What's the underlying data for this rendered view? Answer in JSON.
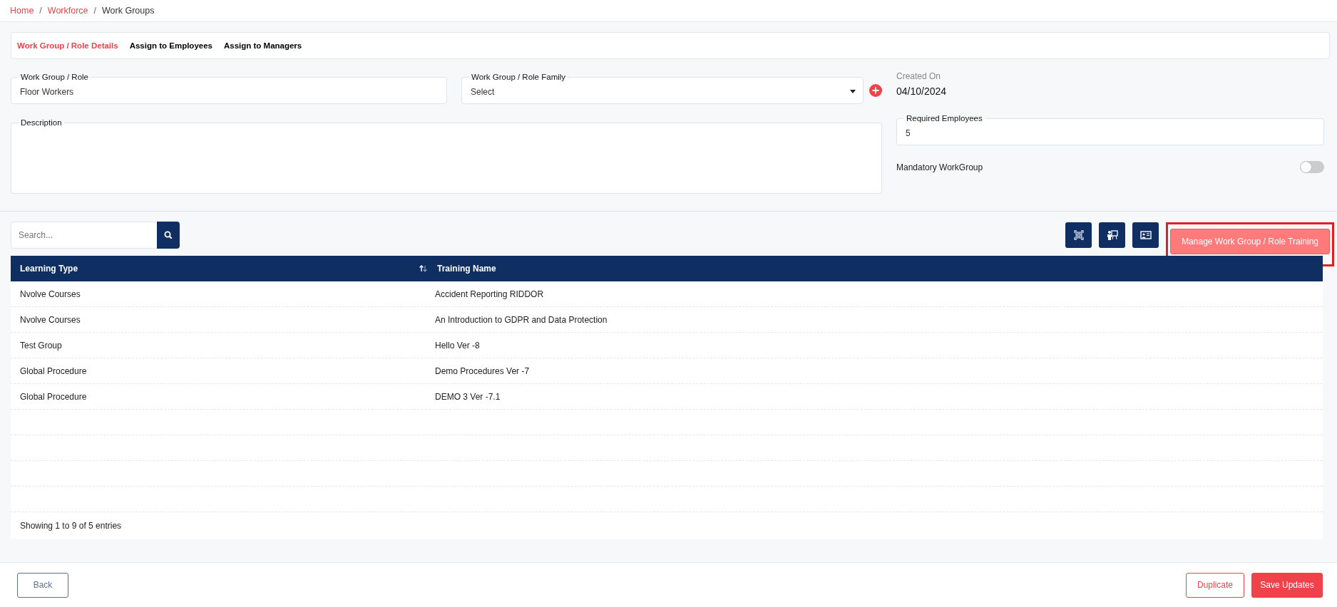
{
  "breadcrumb_separator": "/",
  "breadcrumb": [
    {
      "label": "Home",
      "link": true
    },
    {
      "label": "Workforce",
      "link": true
    },
    {
      "label": "Work Groups",
      "link": false
    }
  ],
  "tabs": [
    {
      "label": "Work Group / Role Details",
      "selected": true
    },
    {
      "label": "Assign to Employees",
      "selected": false
    },
    {
      "label": "Assign to Managers",
      "selected": false
    }
  ],
  "form": {
    "role": {
      "label": "Work Group / Role",
      "value": "Floor Workers"
    },
    "family": {
      "label": "Work Group / Role Family",
      "value": "Select"
    },
    "created": {
      "label": "Created On",
      "value": "04/10/2024"
    },
    "description": {
      "label": "Description"
    },
    "required": {
      "label": "Required Employees",
      "value": "5"
    },
    "mandatory": {
      "label": "Mandatory WorkGroup",
      "on": false
    }
  },
  "search": {
    "placeholder": "Search..."
  },
  "manage_button": "Manage Work Group / Role Training",
  "table": {
    "columns": [
      "Learning Type",
      "Training Name"
    ],
    "rows": [
      [
        "Nvolve Courses",
        "Accident Reporting RIDDOR"
      ],
      [
        "Nvolve Courses",
        "An Introduction to GDPR and Data Protection"
      ],
      [
        "Test Group",
        "Hello Ver -8"
      ],
      [
        "Global Procedure",
        "Demo Procedures Ver -7"
      ],
      [
        "Global Procedure",
        "DEMO 3 Ver -7.1"
      ]
    ],
    "footer": "Showing 1 to 9 of 5 entries"
  },
  "buttons": {
    "back": "Back",
    "duplicate": "Duplicate",
    "save": "Save Updates"
  }
}
